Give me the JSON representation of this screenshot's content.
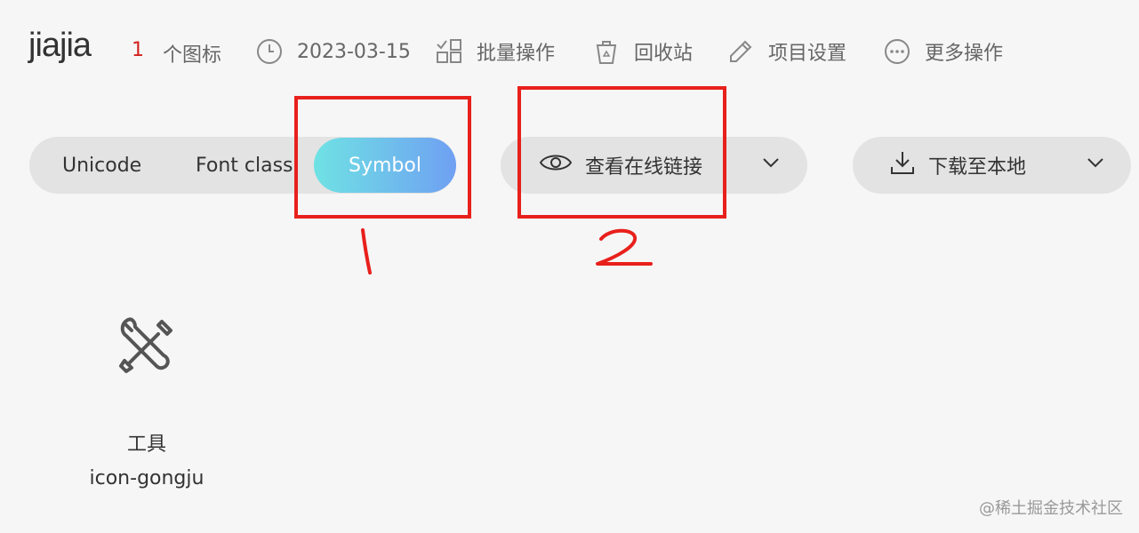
{
  "header": {
    "project_name": "jiajia",
    "icon_count": "1",
    "icon_count_unit": "个图标",
    "date": "2023-03-15",
    "actions": [
      {
        "label": "批量操作",
        "icon": "batch-icon"
      },
      {
        "label": "回收站",
        "icon": "recycle-bin-icon"
      },
      {
        "label": "项目设置",
        "icon": "edit-icon"
      },
      {
        "label": "更多操作",
        "icon": "more-icon"
      }
    ]
  },
  "toolbar": {
    "tabs": [
      "Unicode",
      "Font class",
      "Symbol"
    ],
    "active_tab": "Symbol",
    "view_link_label": "查看在线链接",
    "download_label": "下载至本地"
  },
  "annotations": {
    "mark_1": "1",
    "mark_2": "2",
    "color": "#e8201c"
  },
  "icons": [
    {
      "name": "工具",
      "code": "icon-gongju",
      "glyph": "tools-icon"
    }
  ],
  "watermark": "@稀土掘金技术社区",
  "colors": {
    "accent_start": "#6fe2e4",
    "accent_end": "#6fa0f2",
    "count": "#d4211f"
  }
}
